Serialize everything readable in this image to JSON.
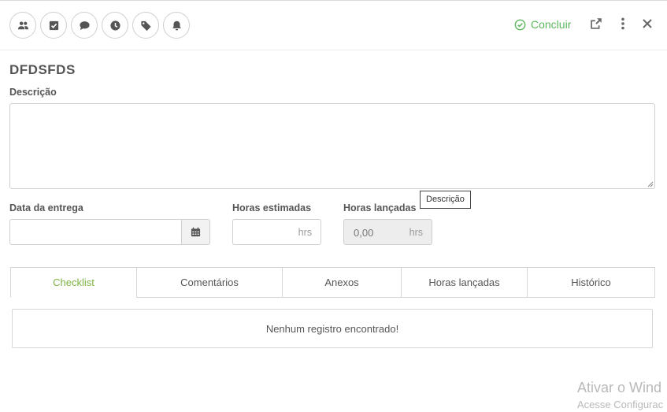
{
  "toolbar": {
    "icons": [
      "users-icon",
      "checkbox-icon",
      "comment-icon",
      "clock-icon",
      "tag-icon",
      "bell-icon"
    ],
    "concluir_label": "Concluir",
    "accent_color": "#5cb85c"
  },
  "task": {
    "title": "DFDSFDS",
    "description_label": "Descrição",
    "description_value": "",
    "tooltip": "Descrição"
  },
  "fields": {
    "data_entrega_label": "Data da entrega",
    "data_entrega_value": "",
    "horas_estimadas_label": "Horas estimadas",
    "horas_estimadas_suffix": "hrs",
    "horas_lancadas_label": "Horas lançadas",
    "horas_lancadas_value": "0,00",
    "horas_lancadas_suffix": "hrs"
  },
  "tabs": [
    {
      "label": "Checklist",
      "active": true
    },
    {
      "label": "Comentários"
    },
    {
      "label": "Anexos"
    },
    {
      "label": "Horas lançadas"
    },
    {
      "label": "Histórico"
    }
  ],
  "empty_message": "Nenhum registro encontrado!",
  "watermark": {
    "line1": "Ativar o Wind",
    "line2": "Acesse Configurac"
  }
}
